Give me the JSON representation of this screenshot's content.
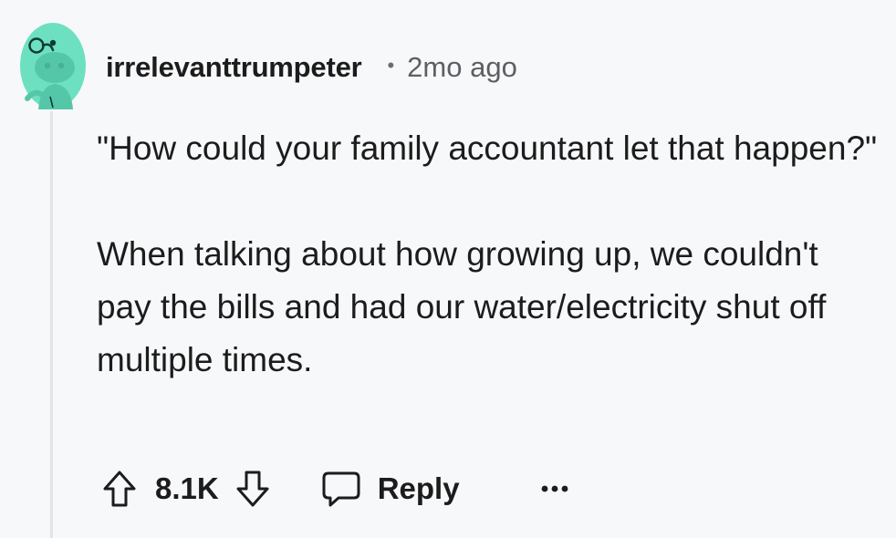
{
  "comment": {
    "author": "irrelevanttrumpeter",
    "separator": "•",
    "timestamp": "2mo ago",
    "paragraphs": [
      "\"How could your family accountant let that happen?\"",
      "When talking about how growing up, we couldn't pay the bills and had our water/electricity shut off multiple times."
    ]
  },
  "actions": {
    "score": "8.1K",
    "reply_label": "Reply"
  },
  "icons": {
    "avatar": "reddit-snoo-avatar-icon",
    "upvote": "upvote-arrow-icon",
    "downvote": "downvote-arrow-icon",
    "reply": "speech-bubble-icon",
    "more": "ellipsis-icon"
  },
  "colors": {
    "background": "#f7f8fa",
    "avatar_bg": "#6ee0c2",
    "text": "#1c1c1c",
    "muted_text": "#5c5f63",
    "thread_line": "#e2e4e7"
  }
}
